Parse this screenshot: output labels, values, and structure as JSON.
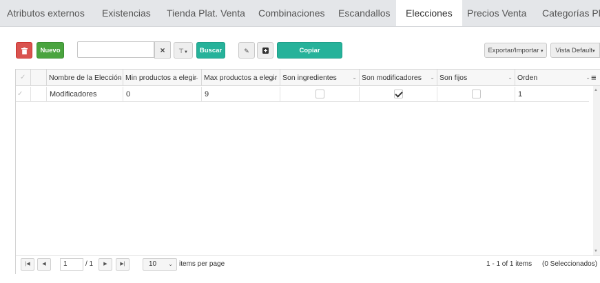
{
  "tabs": [
    {
      "label": "Atributos externos"
    },
    {
      "label": "Existencias"
    },
    {
      "label": "Tienda Plat. Venta"
    },
    {
      "label": "Combinaciones"
    },
    {
      "label": "Escandallos"
    },
    {
      "label": "Elecciones",
      "active": true
    },
    {
      "label": "Precios Venta"
    },
    {
      "label": "Categorías Plat"
    }
  ],
  "toolbar": {
    "delete_icon": "trash-icon",
    "new_label": "Nuevo",
    "search_value": "",
    "search_placeholder": "",
    "clear_label": "×",
    "filter_label": "▼",
    "search_button_label": "Buscar",
    "edit_icon": "edit-icon",
    "add_icon": "plus-square-icon",
    "copy_config_label": "Copiar configuración",
    "export_import_label": "Exportar/Importar",
    "view_label": "Vista Default"
  },
  "grid": {
    "columns": [
      "Nombre de la Elección",
      "Min productos a elegir",
      "Max productos a elegir",
      "Son ingredientes",
      "Son modificadores",
      "Son fijos",
      "Orden"
    ],
    "rows": [
      {
        "nombre": "Modificadores",
        "min": "0",
        "max": "9",
        "son_ingredientes": false,
        "son_modificadores": true,
        "son_fijos": false,
        "orden": "1"
      }
    ]
  },
  "pager": {
    "current_page": "1",
    "total_pages": "/ 1",
    "page_size": "10",
    "items_per_page_label": "items per page",
    "summary": "1 - 1 of 1 items",
    "selected": "(0 Seleccionados)"
  }
}
